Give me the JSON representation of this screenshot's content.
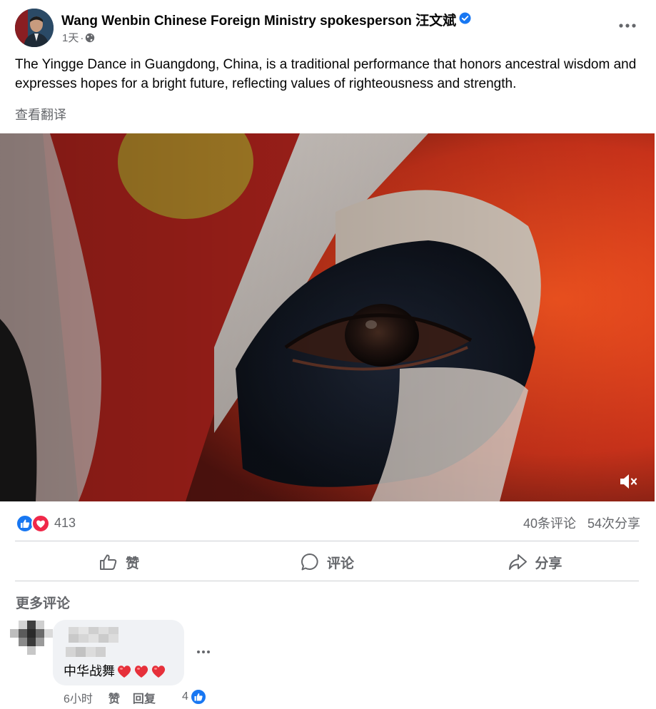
{
  "post": {
    "author": "Wang Wenbin Chinese Foreign Ministry spokesperson 汪文斌",
    "time": "1天",
    "dot": "·",
    "text": "The Yingge Dance in Guangdong, China, is a traditional performance that honors ancestral wisdom and expresses hopes for a bright future, reflecting values of righteousness and strength.",
    "translate_label": "查看翻译"
  },
  "stats": {
    "reaction_count": "413",
    "comments_label": "40条评论",
    "shares_label": "54次分享"
  },
  "actions": {
    "like_label": "赞",
    "comment_label": "评论",
    "share_label": "分享"
  },
  "comments_section": {
    "more_label": "更多评论",
    "items": [
      {
        "text": "中华战舞",
        "time": "6小时",
        "like_label": "赞",
        "reply_label": "回复",
        "like_count": "4"
      }
    ]
  },
  "colors": {
    "brand_blue": "#1877f2",
    "heart_red": "#f02849",
    "muted_text": "#65676b"
  },
  "icons": [
    "verified-badge-icon",
    "globe-icon",
    "more-dots-icon",
    "mute-icon",
    "like-reaction-icon",
    "love-reaction-icon",
    "thumb-up-icon",
    "comment-icon",
    "share-icon",
    "heart-icon"
  ]
}
